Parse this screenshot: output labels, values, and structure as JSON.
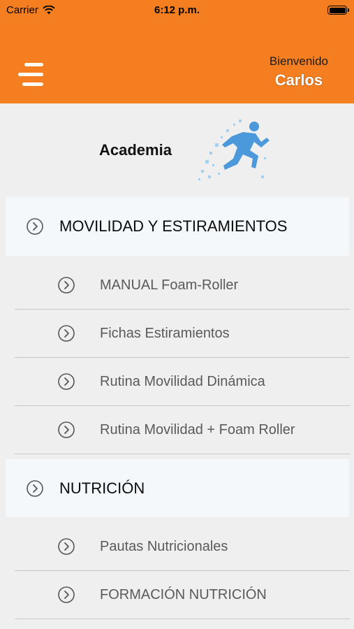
{
  "status_bar": {
    "carrier": "Carrier",
    "time": "6:12 p.m."
  },
  "header": {
    "welcome_label": "Bienvenido",
    "user_name": "Carlos",
    "accent_color": "#f57f20"
  },
  "banner": {
    "title": "Academia"
  },
  "sections": [
    {
      "label": "MOVILIDAD Y ESTIRAMIENTOS",
      "items": [
        "MANUAL Foam-Roller",
        "Fichas Estiramientos",
        "Rutina Movilidad Dinámica",
        "Rutina Movilidad + Foam Roller"
      ]
    },
    {
      "label": "NUTRICIÓN",
      "items": [
        "Pautas Nutricionales",
        "FORMACIÓN NUTRICIÓN"
      ]
    }
  ]
}
